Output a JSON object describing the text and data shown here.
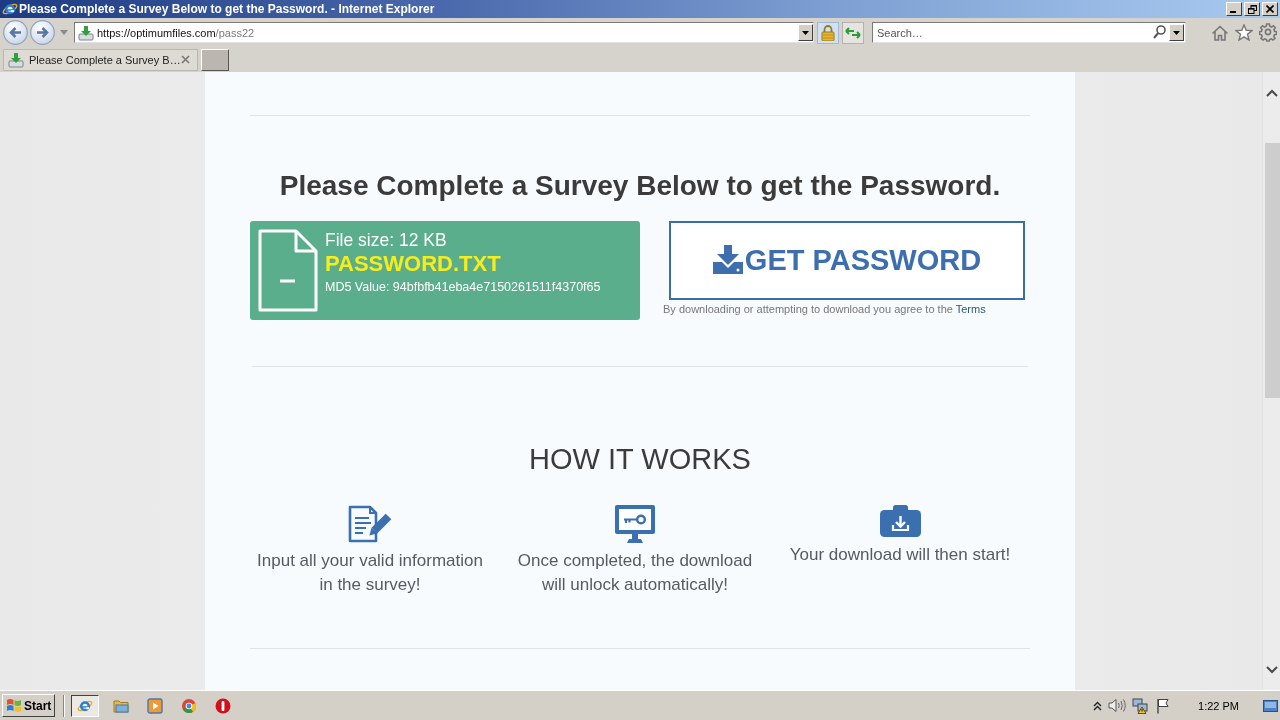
{
  "window": {
    "title": "Please Complete a Survey Below to get the Password. - Internet Explorer"
  },
  "address_bar": {
    "url": [
      {
        "text": "https://optimumfiles.com",
        "dim": false
      },
      {
        "text": "/pass22",
        "dim": true
      }
    ]
  },
  "search": {
    "placeholder": "Search…"
  },
  "tabs": [
    {
      "label": "Please Complete a Survey B…",
      "selected": true
    }
  ],
  "page": {
    "heading": "Please Complete a Survey Below to get the Password.",
    "file": {
      "size": "File size: 12 KB",
      "name": "PASSWORD.TXT",
      "md5": "MD5 Value: 94bfbfb41eba4e7150261511f4370f65"
    },
    "download_button": "GET PASSWORD",
    "terms": {
      "text": "By downloading or attempting to download you agree to the",
      "link": "Terms"
    },
    "how_it_works": {
      "title": "HOW IT WORKS",
      "steps": [
        {
          "kind": "form",
          "text": "Input all your valid information in the survey!"
        },
        {
          "kind": "unlock",
          "text": "Once completed, the download will unlock automatically!"
        },
        {
          "kind": "download",
          "text": "Your download will then start!"
        }
      ]
    }
  },
  "taskbar": {
    "start": "Start",
    "apps": [
      {
        "kind": "ie",
        "selected": true
      },
      {
        "kind": "folder",
        "selected": false
      },
      {
        "kind": "player",
        "selected": false
      },
      {
        "kind": "chrome",
        "selected": false
      },
      {
        "kind": "alert",
        "selected": false
      }
    ],
    "clock": "1:22 PM"
  }
}
